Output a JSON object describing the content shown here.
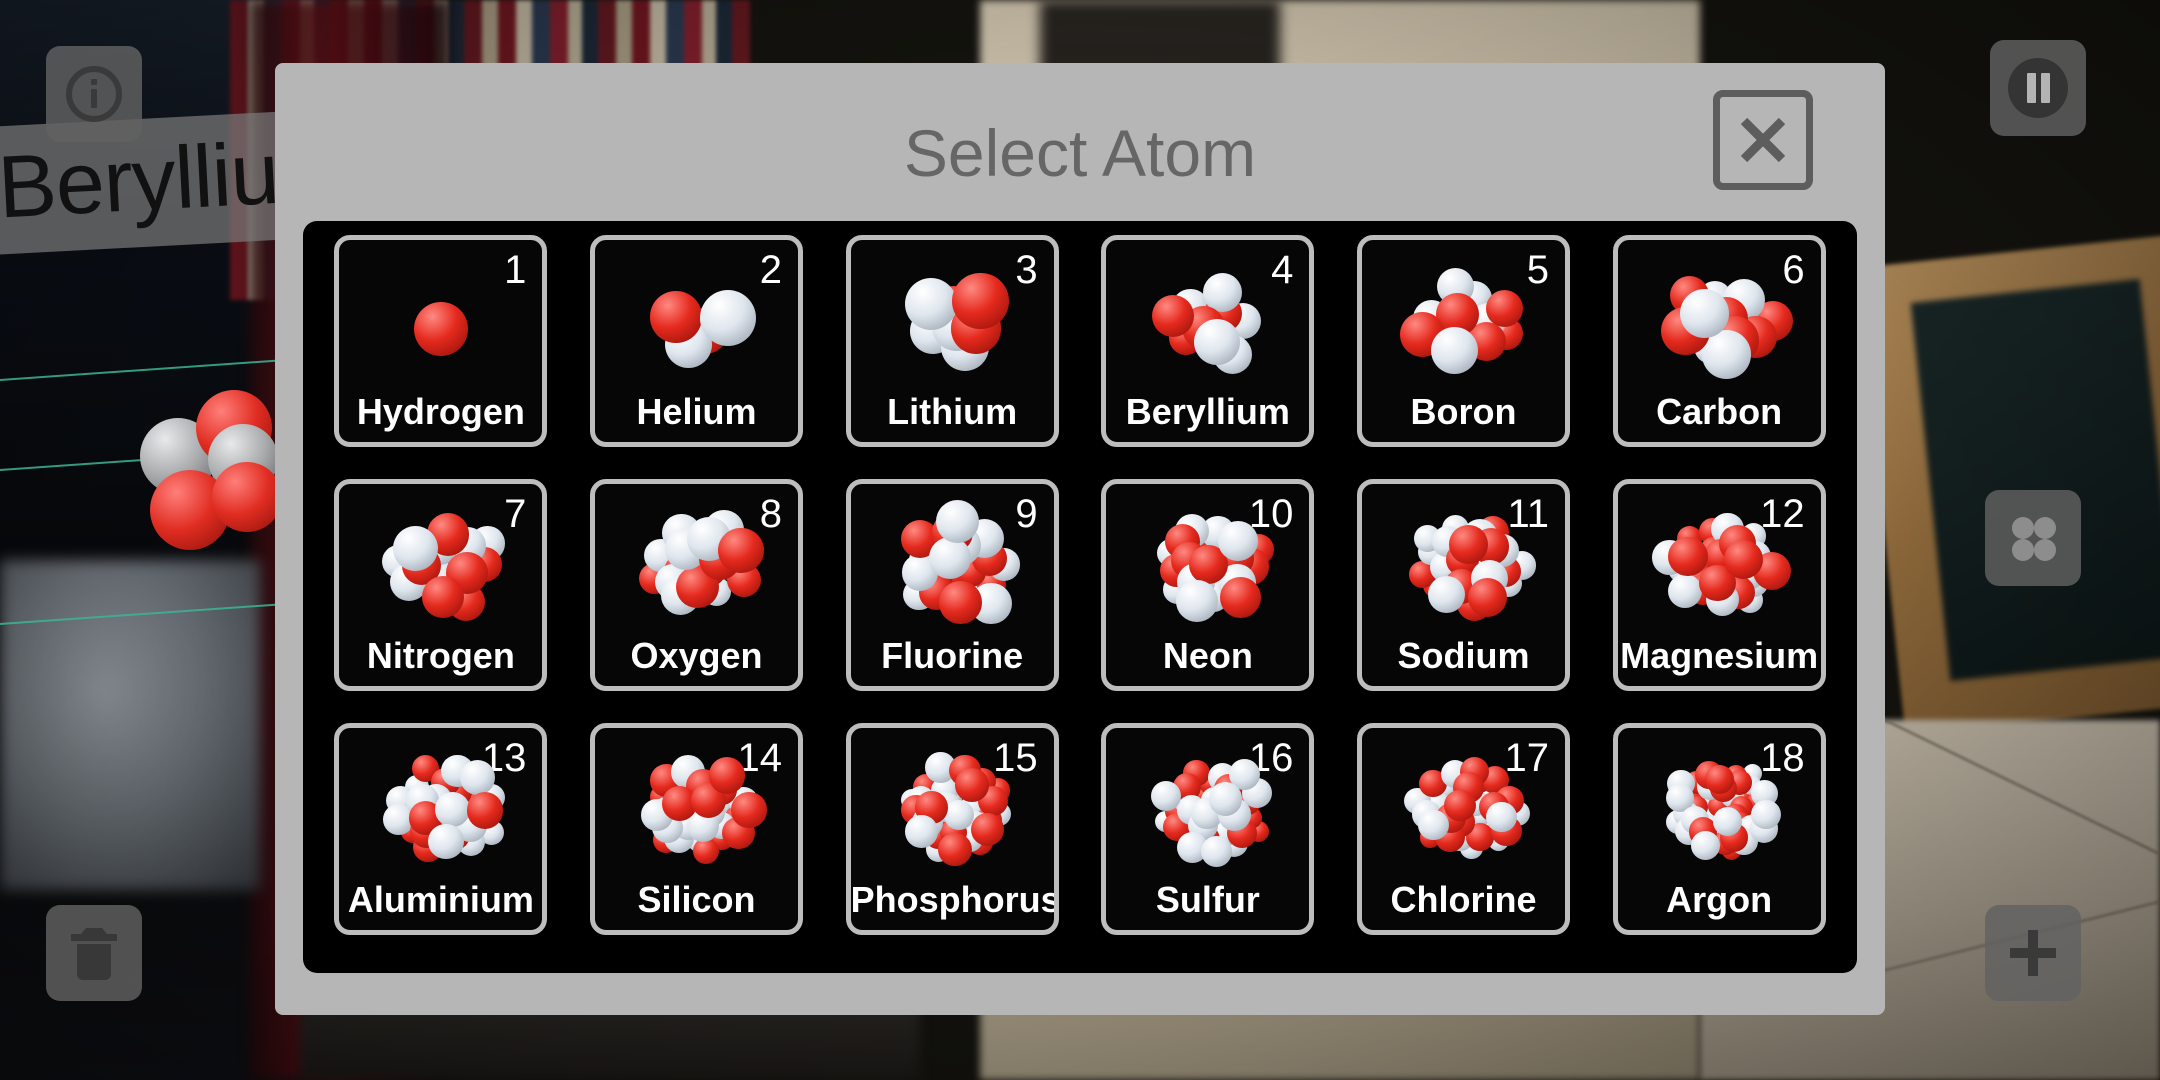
{
  "app": {
    "ar_label": "Beryllium",
    "background_description": "ar-camera-room"
  },
  "tools": {
    "info_label": "Info",
    "pause_label": "Pause",
    "apps_label": "Apps",
    "trash_label": "Delete",
    "add_label": "Add"
  },
  "dialog": {
    "title": "Select Atom",
    "close_label": "Close",
    "colors": {
      "panel": "#b6b6b6",
      "title_text": "#666666",
      "grid_background": "#000000",
      "cell_border": "#bdbdbd",
      "proton": "#e52a1e",
      "neutron": "#ffffff"
    },
    "atoms": [
      {
        "number": "1",
        "name": "Hydrogen",
        "protons": 1,
        "neutrons": 0
      },
      {
        "number": "2",
        "name": "Helium",
        "protons": 2,
        "neutrons": 2
      },
      {
        "number": "3",
        "name": "Lithium",
        "protons": 3,
        "neutrons": 4
      },
      {
        "number": "4",
        "name": "Beryllium",
        "protons": 4,
        "neutrons": 5
      },
      {
        "number": "5",
        "name": "Boron",
        "protons": 5,
        "neutrons": 6
      },
      {
        "number": "6",
        "name": "Carbon",
        "protons": 6,
        "neutrons": 6
      },
      {
        "number": "7",
        "name": "Nitrogen",
        "protons": 7,
        "neutrons": 7
      },
      {
        "number": "8",
        "name": "Oxygen",
        "protons": 8,
        "neutrons": 8
      },
      {
        "number": "9",
        "name": "Fluorine",
        "protons": 9,
        "neutrons": 10
      },
      {
        "number": "10",
        "name": "Neon",
        "protons": 10,
        "neutrons": 10
      },
      {
        "number": "11",
        "name": "Sodium",
        "protons": 11,
        "neutrons": 12
      },
      {
        "number": "12",
        "name": "Magnesium",
        "protons": 12,
        "neutrons": 12
      },
      {
        "number": "13",
        "name": "Aluminium",
        "protons": 13,
        "neutrons": 14
      },
      {
        "number": "14",
        "name": "Silicon",
        "protons": 14,
        "neutrons": 14
      },
      {
        "number": "15",
        "name": "Phosphorus",
        "protons": 15,
        "neutrons": 16
      },
      {
        "number": "16",
        "name": "Sulfur",
        "protons": 16,
        "neutrons": 16
      },
      {
        "number": "17",
        "name": "Chlorine",
        "protons": 17,
        "neutrons": 18
      },
      {
        "number": "18",
        "name": "Argon",
        "protons": 18,
        "neutrons": 22
      }
    ]
  }
}
